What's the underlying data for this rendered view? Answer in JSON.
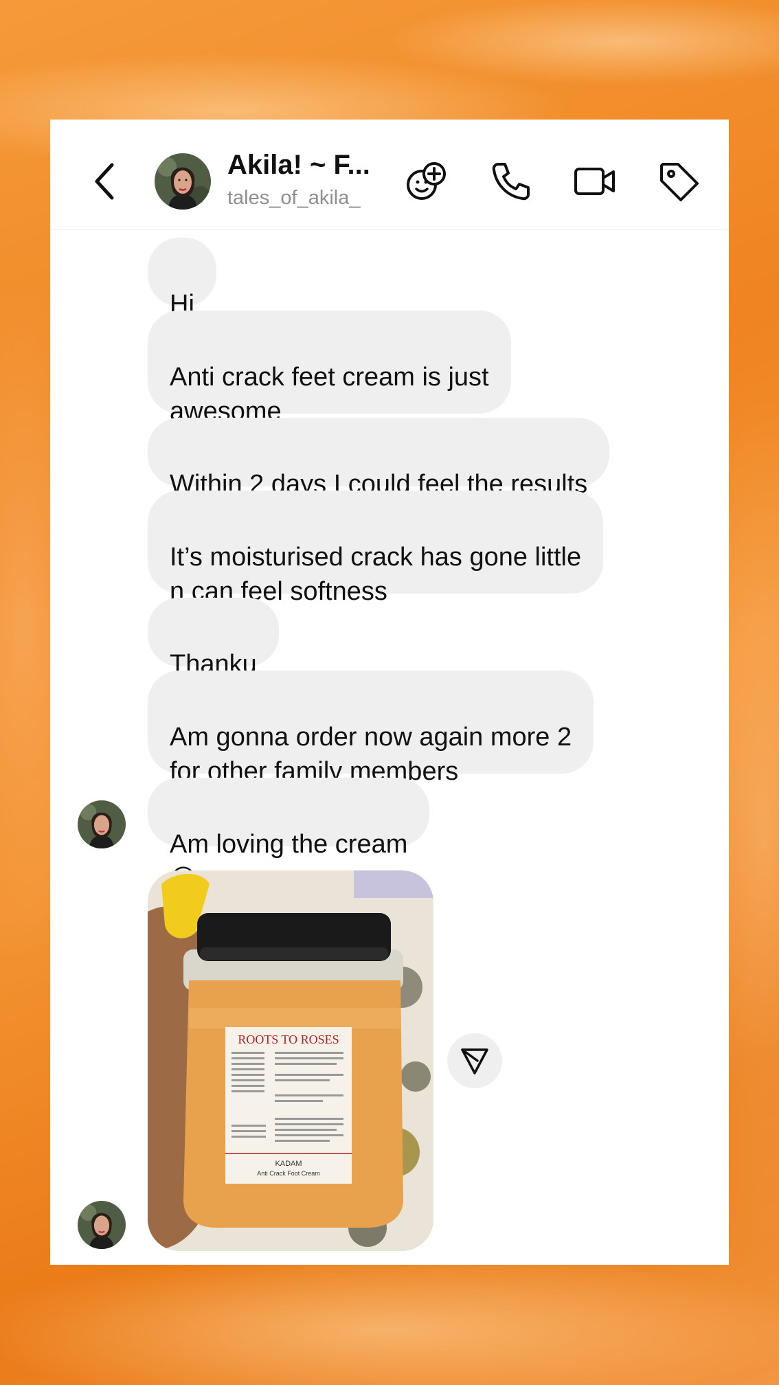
{
  "header": {
    "name": "Akila! ~ F...",
    "handle": "tales_of_akila_"
  },
  "icons": {
    "back": "chevron-left-icon",
    "add_avatar": "avatar-add-icon",
    "call": "phone-icon",
    "video": "video-camera-icon",
    "tag": "tag-icon",
    "share": "send-icon"
  },
  "messages": [
    {
      "text": "Hi"
    },
    {
      "text": "Anti crack feet cream is just\nawesome",
      "emoji": "☺️"
    },
    {
      "text": "Within 2 days I could feel the results"
    },
    {
      "text": "It’s moisturised crack has gone little\nn can feel softness",
      "emoji": "😍"
    },
    {
      "text": "Thanku"
    },
    {
      "text": "Am gonna order now again more 2\nfor other family members"
    },
    {
      "text": "Am loving the cream",
      "emoji": "😍"
    }
  ],
  "photo_label": {
    "brand": "ROOTS TO ROSES",
    "product": "KADAM",
    "subtitle": "Anti Crack Foot Cream"
  },
  "colors": {
    "background": "#ef8420",
    "bubble": "#efefef",
    "text": "#111111",
    "muted": "#8e8e8e"
  }
}
